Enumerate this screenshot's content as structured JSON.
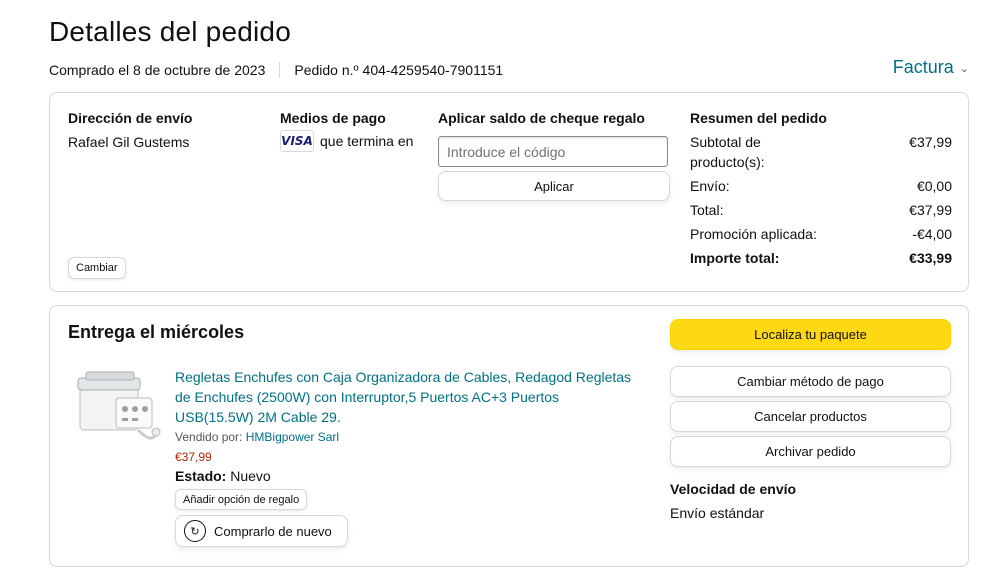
{
  "page": {
    "title": "Detalles del pedido",
    "purchase_date": "Comprado el 8 de octubre de 2023",
    "order_number": "Pedido n.º 404-4259540-7901151",
    "invoice_label": "Factura"
  },
  "shipping": {
    "heading": "Dirección de envío",
    "name": "Rafael Gil Gustems",
    "change_label": "Cambiar"
  },
  "payment": {
    "heading": "Medios de pago",
    "card_brand": "VISA",
    "card_text": "que termina en"
  },
  "gift_card": {
    "heading": "Aplicar saldo de cheque regalo",
    "placeholder": "Introduce el código",
    "apply_label": "Aplicar"
  },
  "summary": {
    "heading": "Resumen del pedido",
    "lines": [
      {
        "label": "Subtotal de producto(s):",
        "value": "€37,99"
      },
      {
        "label": "Envío:",
        "value": "€0,00"
      },
      {
        "label": "Total:",
        "value": "€37,99"
      },
      {
        "label": "Promoción aplicada:",
        "value": "-€4,00"
      },
      {
        "label": "Importe total:",
        "value": "€33,99"
      }
    ]
  },
  "delivery": {
    "heading": "Entrega el miércoles",
    "product": {
      "title": "Regletas Enchufes con Caja Organizadora de Cables, Redagod Regletas de Enchufes (2500W) con Interruptor,5 Puertos AC+3 Puertos USB(15.5W) 2M Cable 29.",
      "seller_prefix": "Vendido por:",
      "seller": "HMBigpower Sarl",
      "price": "€37,99",
      "state_label": "Estado:",
      "state_value": "Nuevo",
      "gift_option_label": "Añadir opción de regalo",
      "rebuy_label": "Comprarlo de nuevo"
    },
    "actions": {
      "track": "Localiza tu paquete",
      "change_payment": "Cambiar método de pago",
      "cancel": "Cancelar productos",
      "archive": "Archivar pedido"
    },
    "speed_heading": "Velocidad de envío",
    "speed_value": "Envío estándar"
  },
  "colors": {
    "link": "#007185",
    "price": "#b12704",
    "primary_button": "#ffd814",
    "border": "#d5d9d9"
  },
  "icons": {
    "invoice_chevron": "chevron-down-icon",
    "rebuy": "rebuy-icon",
    "card": "visa-icon"
  }
}
